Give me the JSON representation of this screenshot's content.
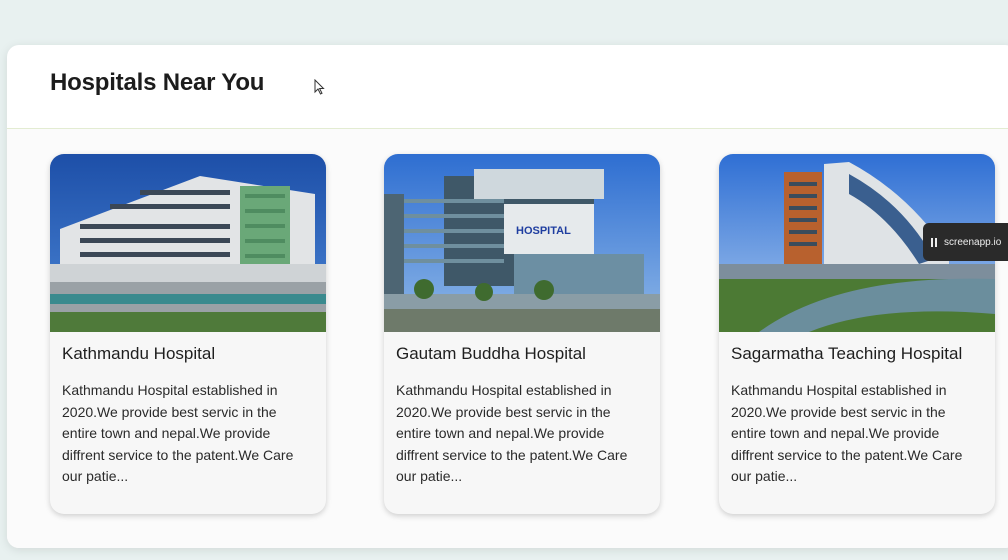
{
  "section": {
    "title": "Hospitals Near You"
  },
  "hospitals": [
    {
      "name": "Kathmandu Hospital",
      "description": "Kathmandu Hospital established in 2020.We provide best servic in the entire town and nepal.We provide diffrent service to the patent.We Care our patie..."
    },
    {
      "name": "Gautam Buddha Hospital",
      "description": "Kathmandu Hospital established in 2020.We provide best servic in the entire town and nepal.We provide diffrent service to the patent.We Care our patie...",
      "sign_text": "HOSPITAL"
    },
    {
      "name": "Sagarmatha Teaching Hospital",
      "description": "Kathmandu Hospital established in 2020.We provide best servic in the entire town and nepal.We provide diffrent service to the patent.We Care our patie..."
    }
  ],
  "recorder": {
    "label": "screenapp.io"
  },
  "colors": {
    "background": "#e8f1f0",
    "panel": "#ffffff",
    "sky": "#2d66c4"
  }
}
